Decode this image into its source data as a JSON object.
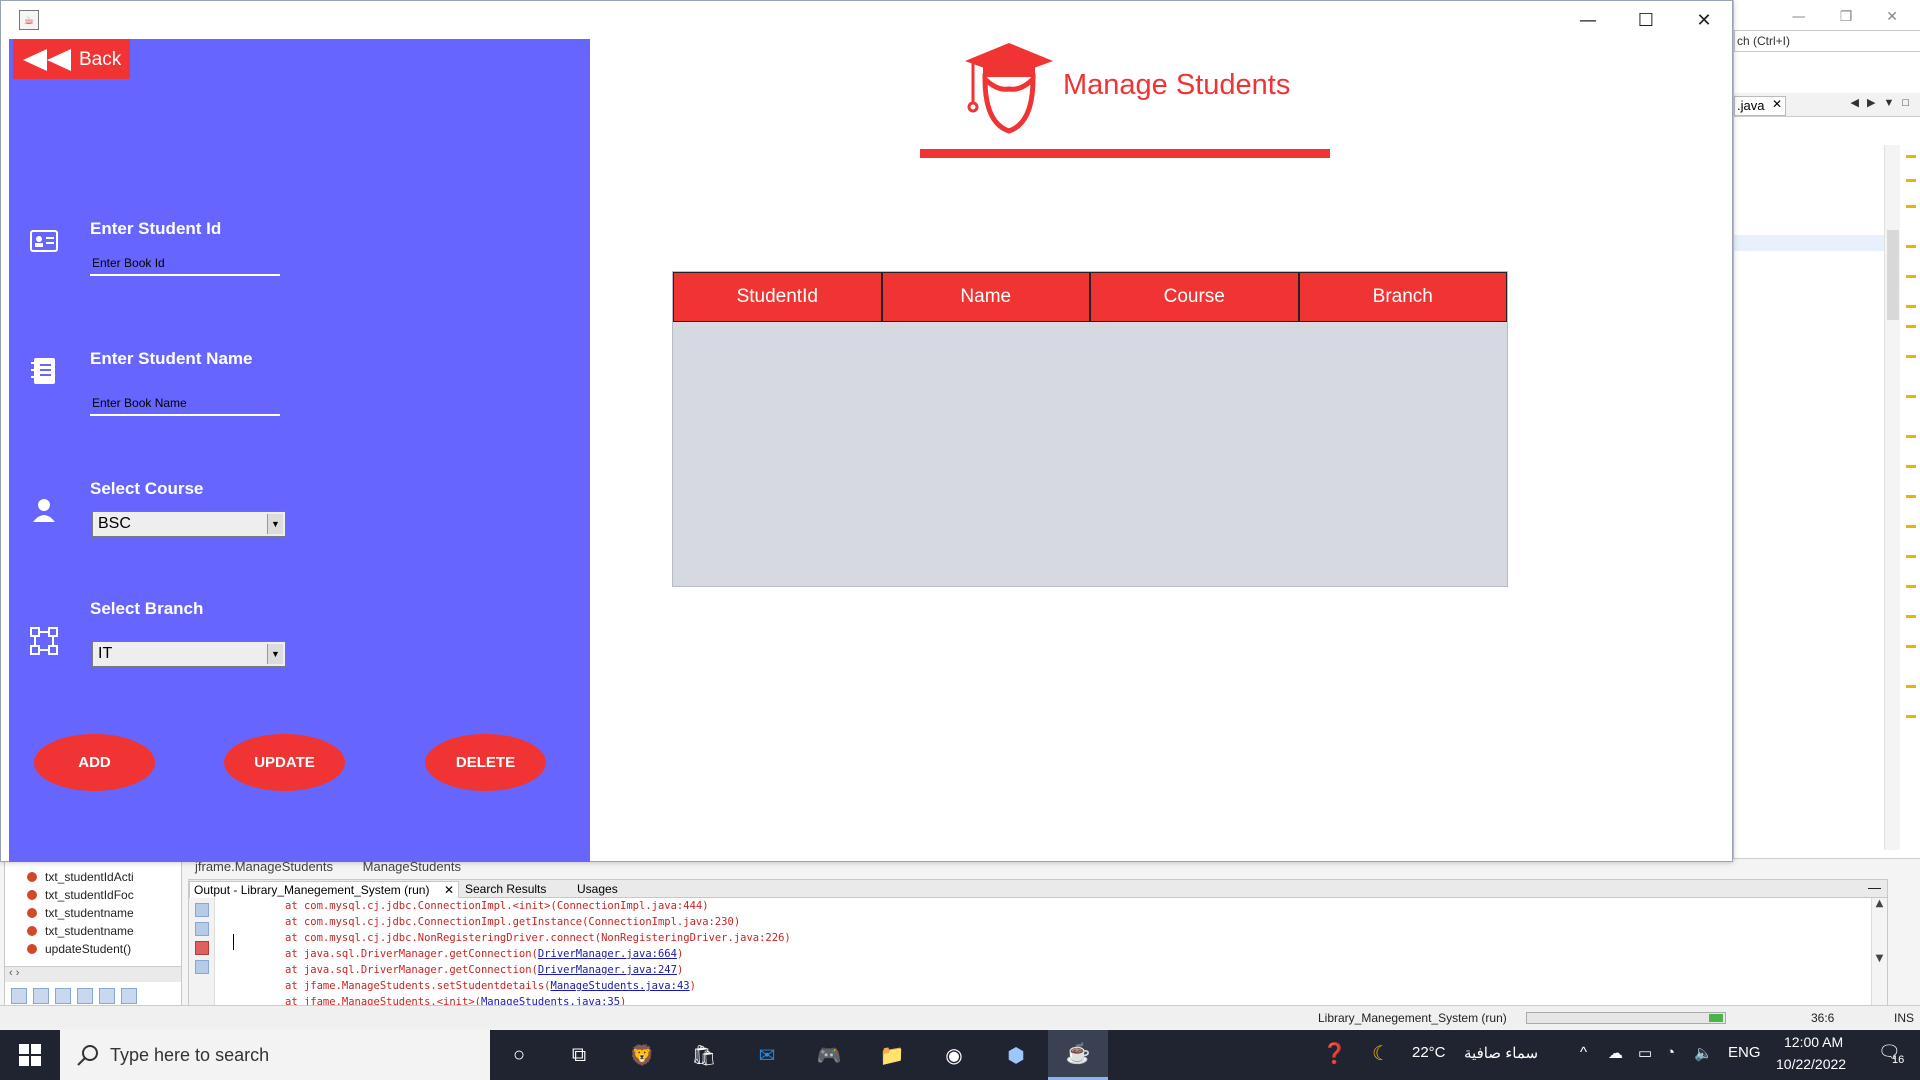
{
  "ide": {
    "search_placeholder": "ch (Ctrl+I)",
    "editor_tab": ".java",
    "nav_items": [
      "txt_studentIdActi",
      "txt_studentIdFoc",
      "txt_studentname",
      "txt_studentname",
      "updateStudent()"
    ],
    "breadcrumbs": [
      "jframe.ManageStudents",
      "ManageStudents"
    ],
    "output_tabs": [
      "Output - Library_Manegement_System (run)",
      "Search Results",
      "Usages"
    ],
    "output_lines": [
      {
        "text": "at com.mysql.cj.jdbc.ConnectionImpl.<init>(ConnectionImpl.java:444)",
        "link": ""
      },
      {
        "text": "at com.mysql.cj.jdbc.ConnectionImpl.getInstance(ConnectionImpl.java:230)",
        "link": ""
      },
      {
        "text": "at com.mysql.cj.jdbc.NonRegisteringDriver.connect(NonRegisteringDriver.java:226)",
        "link": ""
      },
      {
        "text": "at java.sql.DriverManager.getConnection(",
        "link": "DriverManager.java:664"
      },
      {
        "text": "at java.sql.DriverManager.getConnection(",
        "link": "DriverManager.java:247"
      },
      {
        "text": "at jfame.ManageStudents.setStudentdetails(",
        "link": "ManageStudents.java:43"
      },
      {
        "text": "at jfame.ManageStudents.<init>(",
        "link": "ManageStudents.java:35"
      }
    ],
    "status": {
      "project": "Library_Manegement_System (run)",
      "position": "36:6",
      "mode": "INS"
    }
  },
  "app": {
    "back_label": "Back",
    "title": "Manage Students",
    "form": {
      "student_id_label": "Enter Student Id",
      "student_id_value": "Enter Book Id",
      "student_name_label": "Enter Student Name",
      "student_name_value": "Enter Book Name",
      "course_label": "Select Course",
      "course_value": "BSC",
      "branch_label": "Select Branch",
      "branch_value": "IT"
    },
    "buttons": {
      "add": "ADD",
      "update": "UPDATE",
      "delete": "DELETE"
    },
    "table": {
      "columns": [
        "StudentId",
        "Name",
        "Course",
        "Branch"
      ],
      "rows": []
    },
    "colors": {
      "accent": "#f03434",
      "panel": "#6666ff",
      "table_bg": "#d6d9e0"
    }
  },
  "taskbar": {
    "search_placeholder": "Type here to search",
    "weather_temp": "22°C",
    "weather_text": "سماء صافية",
    "lang": "ENG",
    "time": "12:00 AM",
    "date": "10/22/2022",
    "notif_count": "16"
  }
}
